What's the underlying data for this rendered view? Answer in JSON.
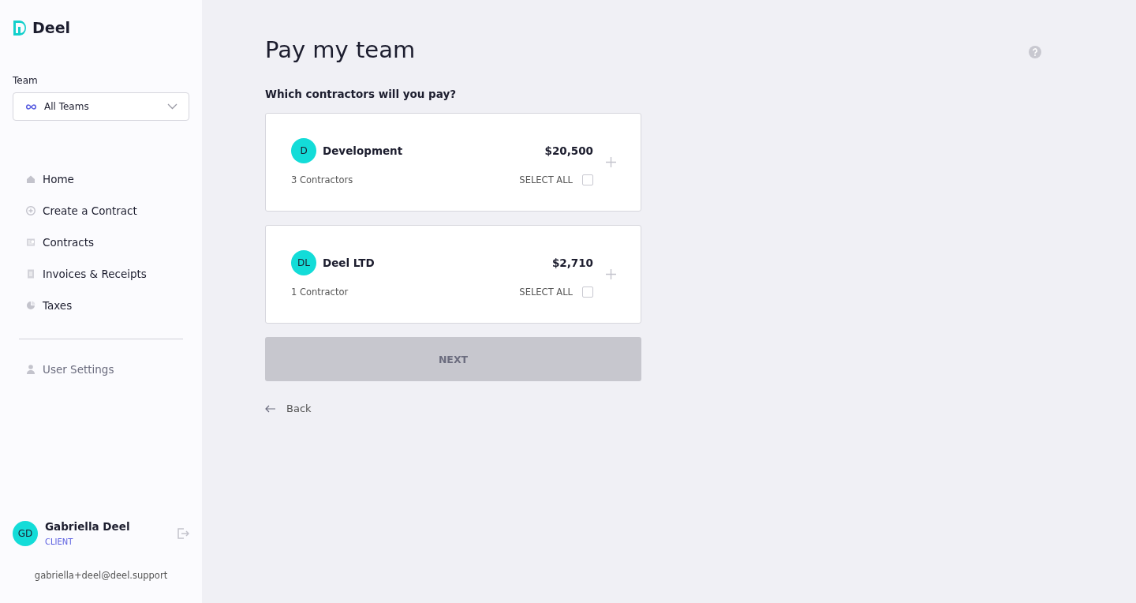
{
  "sidebar": {
    "logo": "Deel",
    "team_label": "Team",
    "team_select": {
      "value": "All Teams"
    },
    "nav_items": [
      {
        "label": "Home"
      },
      {
        "label": "Create a Contract"
      },
      {
        "label": "Contracts"
      },
      {
        "label": "Invoices & Receipts"
      },
      {
        "label": "Taxes"
      }
    ],
    "settings_item": {
      "label": "User Settings"
    },
    "user": {
      "initials": "GD",
      "name": "Gabriella Deel",
      "role": "CLIENT",
      "email": "gabriella+deel@deel.support"
    }
  },
  "main": {
    "title": "Pay my team",
    "question": "Which contractors will you pay?",
    "groups": [
      {
        "initials": "D",
        "name": "Development",
        "amount": "$20,500",
        "count": "3 Contractors",
        "select_label": "SELECT ALL",
        "checked": false
      },
      {
        "initials": "DL",
        "name": "Deel LTD",
        "amount": "$2,710",
        "count": "1 Contractor",
        "select_label": "SELECT ALL",
        "checked": false
      }
    ],
    "next_button": {
      "label": "NEXT",
      "disabled": true
    },
    "back_link": {
      "label": "Back"
    }
  }
}
